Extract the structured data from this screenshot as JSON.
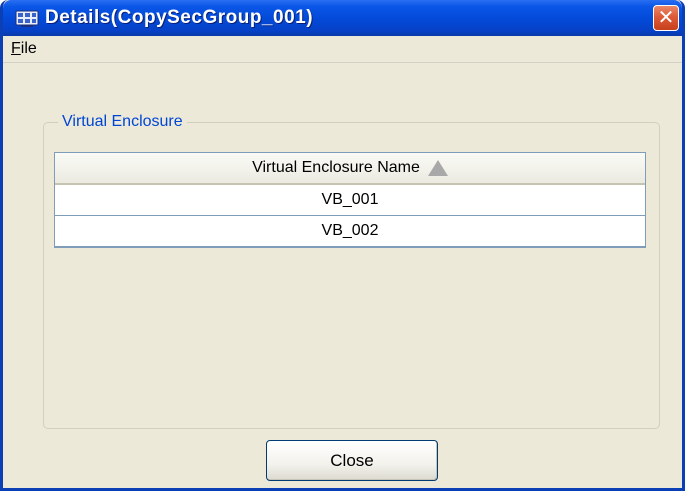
{
  "window": {
    "title": "Details(CopySecGroup_001)",
    "app_icon": "app-window-icon",
    "close_glyph": "✕"
  },
  "menu": {
    "file_mnemonic": "F",
    "file_rest": "ile"
  },
  "group": {
    "label": "Virtual Enclosure"
  },
  "table": {
    "column_header": "Virtual Enclosure Name",
    "sort": "ascending",
    "rows": [
      "VB_001",
      "VB_002"
    ]
  },
  "buttons": {
    "close_label": "Close"
  },
  "colors": {
    "titlebar": "#0349d8",
    "window_bg": "#ece9d8",
    "group_label": "#0046d5",
    "close_button_red": "#dd5a37"
  }
}
